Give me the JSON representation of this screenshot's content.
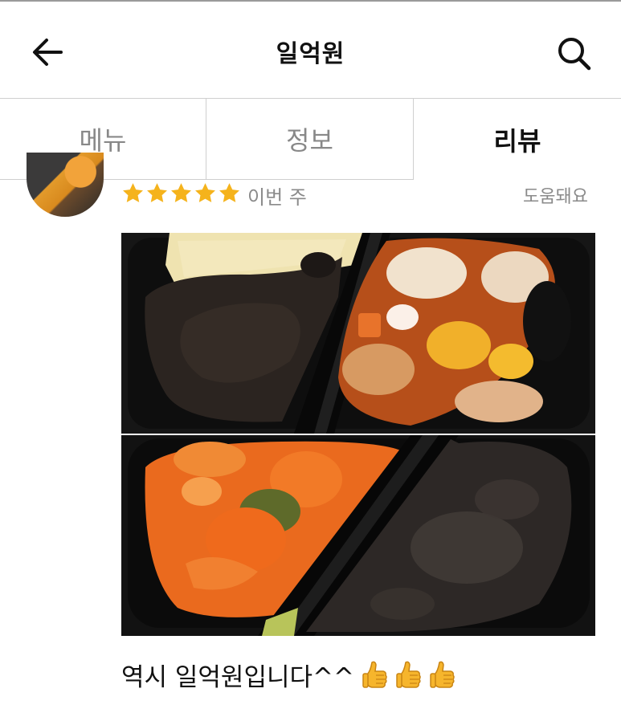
{
  "header": {
    "title": "일억원"
  },
  "tabs": [
    {
      "label": "메뉴",
      "active": false
    },
    {
      "label": "정보",
      "active": false
    },
    {
      "label": "리뷰",
      "active": true
    }
  ],
  "review": {
    "rating": 5,
    "rating_max": 5,
    "date": "이번 주",
    "helpful_label": "도움돼요",
    "text": "역시 일억원입니다^^",
    "emoji_icons": [
      "thumbs-up-icon",
      "thumbs-up-icon",
      "thumbs-up-icon"
    ]
  },
  "colors": {
    "star": "#F5B31C",
    "muted_text": "#8A8A8A",
    "divider": "#CFCFCF"
  }
}
